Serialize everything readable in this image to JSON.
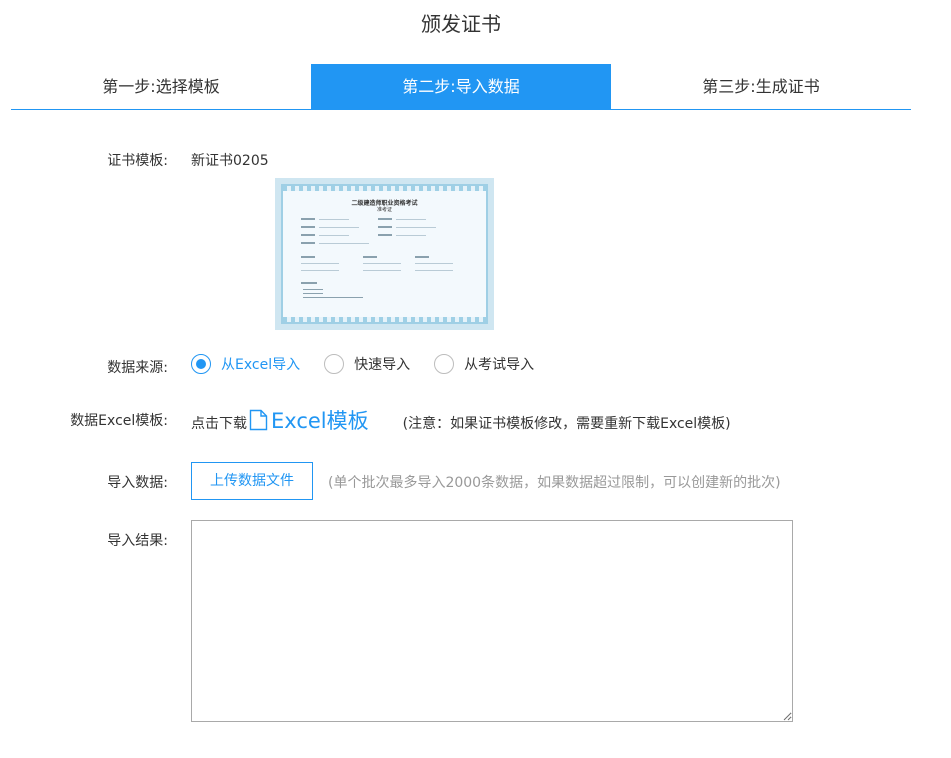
{
  "page": {
    "title": "颁发证书"
  },
  "steps": [
    {
      "label": "第一步:选择模板",
      "active": false
    },
    {
      "label": "第二步:导入数据",
      "active": true
    },
    {
      "label": "第三步:生成证书",
      "active": false
    }
  ],
  "template": {
    "label": "证书模板:",
    "name": "新证书0205",
    "thumbnail": {
      "title_line1": "二级建造师职业资格考试",
      "title_line2": "准考证"
    }
  },
  "data_source": {
    "label": "数据来源:",
    "options": [
      {
        "label": "从Excel导入",
        "checked": true
      },
      {
        "label": "快速导入",
        "checked": false
      },
      {
        "label": "从考试导入",
        "checked": false
      }
    ]
  },
  "excel_template": {
    "label": "数据Excel模板:",
    "prefix": "点击下载",
    "link_text": "Excel模板",
    "icon": "file-icon",
    "note": "(注意：如果证书模板修改，需要重新下载Excel模板)"
  },
  "import_data": {
    "label": "导入数据:",
    "button_label": "上传数据文件",
    "hint": "(单个批次最多导入2000条数据，如果数据超过限制，可以创建新的批次)"
  },
  "import_result": {
    "label": "导入结果:",
    "value": ""
  },
  "colors": {
    "accent": "#2196f3",
    "text": "#333333",
    "hint": "#999999"
  }
}
